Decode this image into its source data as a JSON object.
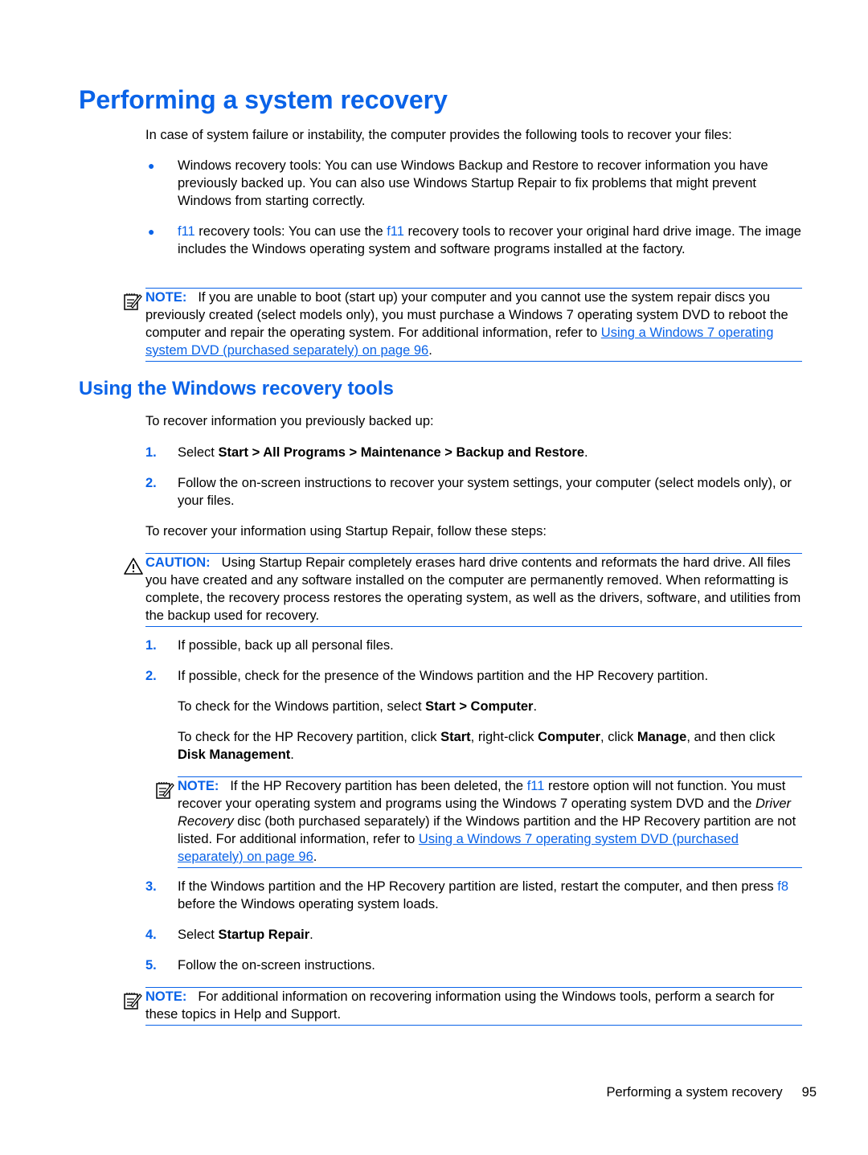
{
  "page": {
    "title": "Performing a system recovery",
    "intro": "In case of system failure or instability, the computer provides the following tools to recover your files:",
    "bullets": [
      {
        "text": "Windows recovery tools: You can use Windows Backup and Restore to recover information you have previously backed up. You can also use Windows Startup Repair to fix problems that might prevent Windows from starting correctly."
      },
      {
        "key": "f11",
        "text_a": " recovery tools: You can use the ",
        "key2": "f11",
        "text_b": " recovery tools to recover your original hard drive image. The image includes the Windows operating system and software programs installed at the factory."
      }
    ],
    "note1": {
      "label": "NOTE:",
      "text": "If you are unable to boot (start up) your computer and you cannot use the system repair discs you previously created (select models only), you must purchase a Windows 7 operating system DVD to reboot the computer and repair the operating system. For additional information, refer to ",
      "link": "Using a Windows 7 operating system DVD (purchased separately) on page 96",
      "end": "."
    },
    "section_title": "Using the Windows recovery tools",
    "backup_intro": "To recover information you previously backed up:",
    "steps_backup": [
      {
        "num": "1.",
        "pre": "Select ",
        "bold": "Start > All Programs > Maintenance > Backup and Restore",
        "post": "."
      },
      {
        "num": "2.",
        "text": "Follow the on-screen instructions to recover your system settings, your computer (select models only), or your files."
      }
    ],
    "startup_intro": "To recover your information using Startup Repair, follow these steps:",
    "caution": {
      "label": "CAUTION:",
      "text": "Using Startup Repair completely erases hard drive contents and reformats the hard drive. All files you have created and any software installed on the computer are permanently removed. When reformatting is complete, the recovery process restores the operating system, as well as the drivers, software, and utilities from the backup used for recovery."
    },
    "steps_startup": {
      "s1": {
        "num": "1.",
        "text": "If possible, back up all personal files."
      },
      "s2": {
        "num": "2.",
        "text": "If possible, check for the presence of the Windows partition and the HP Recovery partition."
      },
      "s2_sub1": {
        "pre": "To check for the Windows partition, select ",
        "bold": "Start > Computer",
        "post": "."
      },
      "s2_sub2": {
        "a": "To check for the HP Recovery partition, click ",
        "b1": "Start",
        "c": ", right-click ",
        "b2": "Computer",
        "d": ", click ",
        "b3": "Manage",
        "e": ", and then click ",
        "b4": "Disk Management",
        "f": "."
      },
      "note2": {
        "label": "NOTE:",
        "a": "If the HP Recovery partition has been deleted, the ",
        "key": "f11",
        "b": " restore option will not function. You must recover your operating system and programs using the Windows 7 operating system DVD and the ",
        "italic": "Driver Recovery",
        "c": " disc (both purchased separately) if the Windows partition and the HP Recovery partition are not listed. For additional information, refer to ",
        "link": "Using a Windows 7 operating system DVD (purchased separately) on page 96",
        "end": "."
      },
      "s3": {
        "num": "3.",
        "a": "If the Windows partition and the HP Recovery partition are listed, restart the computer, and then press ",
        "key": "f8",
        "b": " before the Windows operating system loads."
      },
      "s4": {
        "num": "4.",
        "pre": "Select ",
        "bold": "Startup Repair",
        "post": "."
      },
      "s5": {
        "num": "5.",
        "text": "Follow the on-screen instructions."
      }
    },
    "note3": {
      "label": "NOTE:",
      "text": "For additional information on recovering information using the Windows tools, perform a search for these topics in Help and Support."
    },
    "footer": {
      "section": "Performing a system recovery",
      "page_number": "95"
    }
  }
}
